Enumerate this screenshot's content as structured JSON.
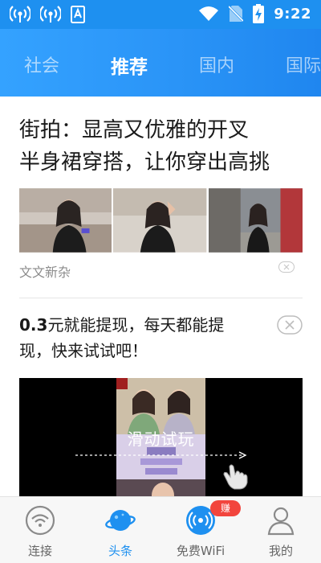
{
  "status_bar": {
    "time": "9:22",
    "icons_left": [
      "wifi-hotspot-icon",
      "wifi-hotspot-icon",
      "keyboard-a-icon"
    ],
    "icons_right": [
      "wifi-signal-icon",
      "no-sim-icon",
      "battery-charging-icon"
    ]
  },
  "tabs": [
    {
      "label": "社会",
      "active": false
    },
    {
      "label": "推荐",
      "active": true
    },
    {
      "label": "国内",
      "active": false
    },
    {
      "label": "国际",
      "active": false
    }
  ],
  "article": {
    "title_line1": "街拍：显高又优雅的开叉",
    "title_line2": "半身裙穿搭，让你穿出高挑",
    "source": "文文新杂"
  },
  "ad": {
    "amount": "0.3",
    "title_rest_line1": "元就能提现，每天都能提",
    "title_line2": "现，快来试试吧！",
    "video_label": "滑动试玩"
  },
  "bottom_nav": [
    {
      "label": "连接",
      "icon": "wifi-connect-icon",
      "active": false
    },
    {
      "label": "头条",
      "icon": "planet-icon",
      "active": true
    },
    {
      "label": "免费WiFi",
      "icon": "free-wifi-icon",
      "active": false,
      "badge": "赚"
    },
    {
      "label": "我的",
      "icon": "user-profile-icon",
      "active": false
    }
  ],
  "colors": {
    "brand_blue": "#1e90f0",
    "badge_red": "#f2453d"
  }
}
